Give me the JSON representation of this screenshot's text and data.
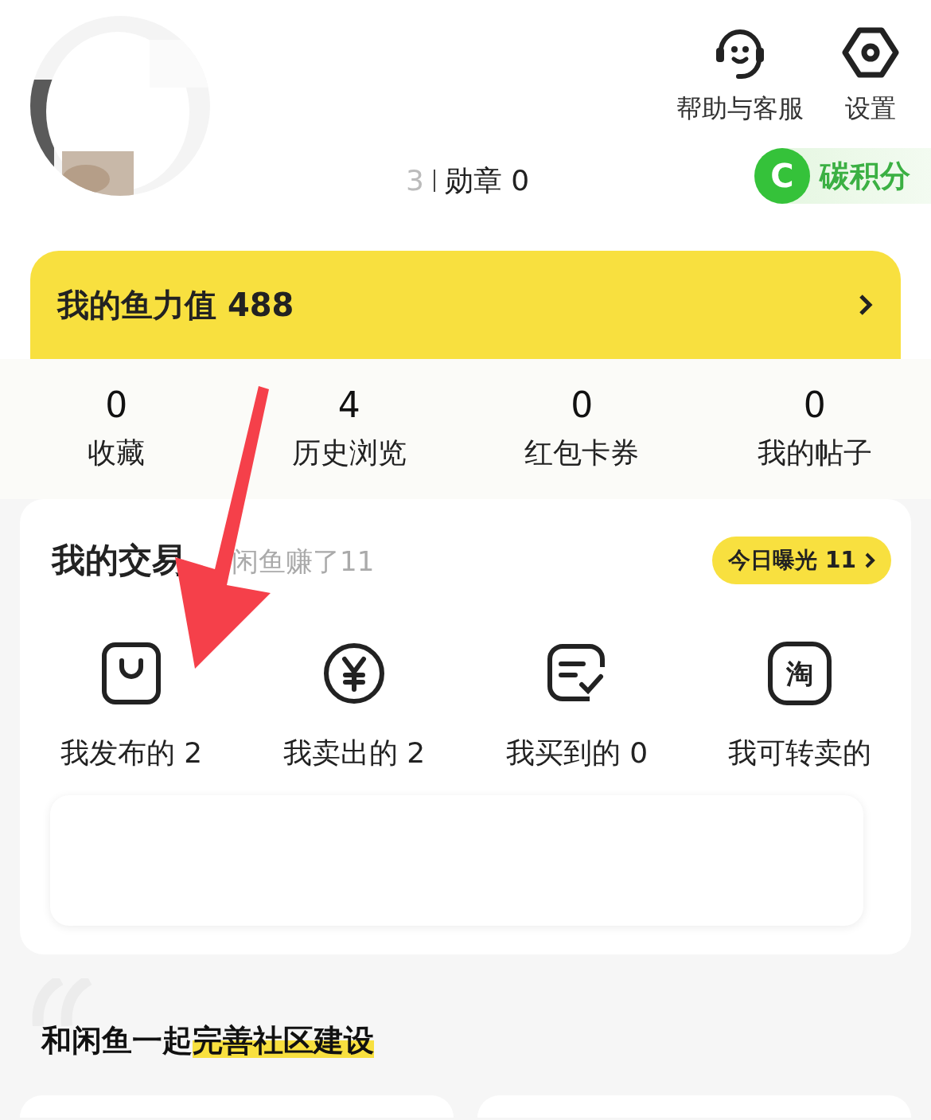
{
  "profile": {
    "stats_partial": "3",
    "medals": "勋章 0"
  },
  "header_actions": [
    {
      "kind": "support",
      "label": "帮助与客服"
    },
    {
      "kind": "settings",
      "label": "设置"
    }
  ],
  "carbon_badge": {
    "icon": "C",
    "label": "碳积分"
  },
  "fish_power": {
    "label": "我的鱼力值",
    "value": "488"
  },
  "counters": [
    {
      "value": "0",
      "label": "收藏"
    },
    {
      "value": "4",
      "label": "历史浏览"
    },
    {
      "value": "0",
      "label": "红包卡券"
    },
    {
      "value": "0",
      "label": "我的帖子"
    }
  ],
  "trades": {
    "title": "我的交易",
    "subtitle": "闲鱼赚了11",
    "exposure": "今日曝光 11",
    "items": [
      {
        "kind": "bag",
        "label": "我发布的 2"
      },
      {
        "kind": "yen",
        "label": "我卖出的 2"
      },
      {
        "kind": "check",
        "label": "我买到的 0"
      },
      {
        "kind": "tao",
        "icon": "淘",
        "label": "我可转卖的"
      }
    ]
  },
  "community": {
    "title": "和闲鱼一起",
    "highlight": "完善社区建设"
  }
}
